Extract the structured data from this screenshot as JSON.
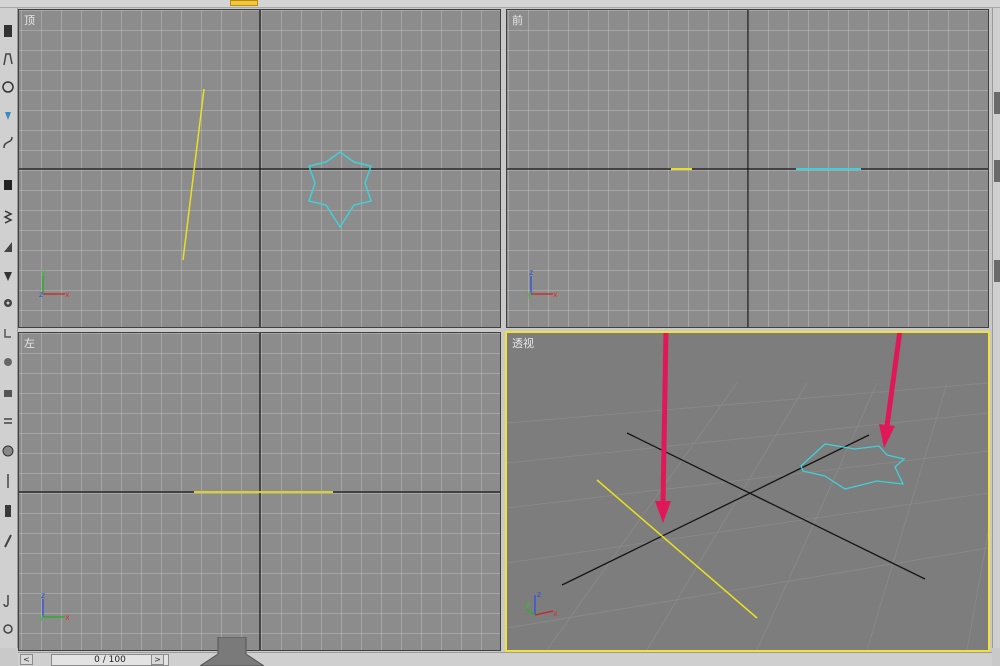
{
  "viewports": {
    "top": {
      "label": "顶"
    },
    "front": {
      "label": "前"
    },
    "left": {
      "label": "左"
    },
    "perspective": {
      "label": "透视"
    }
  },
  "axes": {
    "x": "x",
    "y": "y",
    "z": "z"
  },
  "timeline": {
    "frame_display": "0 / 100",
    "prev_icon": "chevron-left-icon",
    "next_icon": "chevron-right-icon"
  },
  "colors": {
    "viewport_bg": "#8c8c8c",
    "grid": "#c4c4c4",
    "active_border": "#f0e23a",
    "line_object": "#e8e020",
    "star_object": "#40d0d8",
    "arrow": "#e0185a"
  }
}
